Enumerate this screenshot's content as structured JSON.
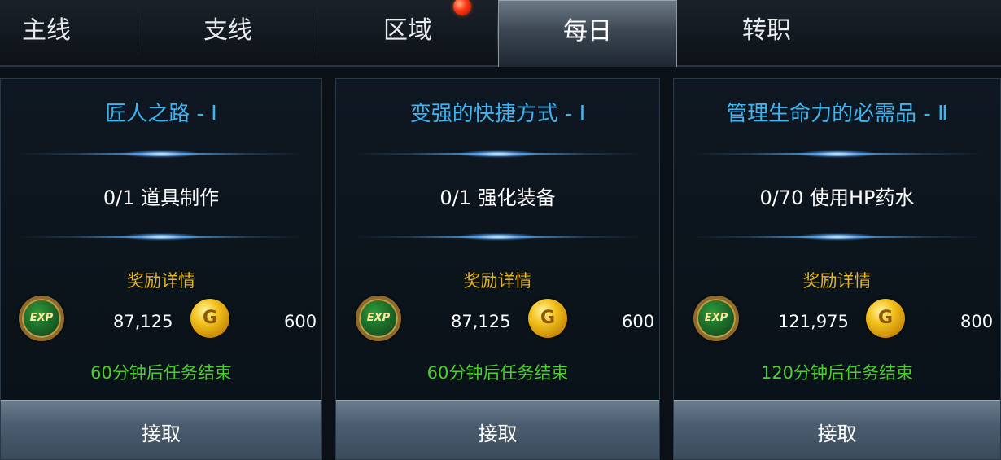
{
  "tabs": [
    {
      "label": "主线"
    },
    {
      "label": "支线"
    },
    {
      "label": "区域"
    },
    {
      "label": "每日"
    },
    {
      "label": "转职"
    }
  ],
  "active_tab": "每日",
  "cards": [
    {
      "title": "匠人之路 - Ⅰ",
      "objective": "0/1 道具制作",
      "reward_title": "奖励详情",
      "exp_icon_label": "EXP",
      "exp_value": "87,125",
      "gold_icon_label": "G",
      "gold_value": "600",
      "timer": "60分钟后任务结束",
      "button": "接取"
    },
    {
      "title": "变强的快捷方式 - Ⅰ",
      "objective": "0/1 强化装备",
      "reward_title": "奖励详情",
      "exp_icon_label": "EXP",
      "exp_value": "87,125",
      "gold_icon_label": "G",
      "gold_value": "600",
      "timer": "60分钟后任务结束",
      "button": "接取"
    },
    {
      "title": "管理生命力的必需品 - Ⅱ",
      "objective": "0/70 使用HP药水",
      "reward_title": "奖励详情",
      "exp_icon_label": "EXP",
      "exp_value": "121,975",
      "gold_icon_label": "G",
      "gold_value": "800",
      "timer": "120分钟后任务结束",
      "button": "接取"
    }
  ],
  "colors": {
    "title_blue": "#3fb4ee",
    "reward_gold": "#e3b52a",
    "timer_green": "#4ccf2e",
    "badge_red": "#ff3b14"
  }
}
